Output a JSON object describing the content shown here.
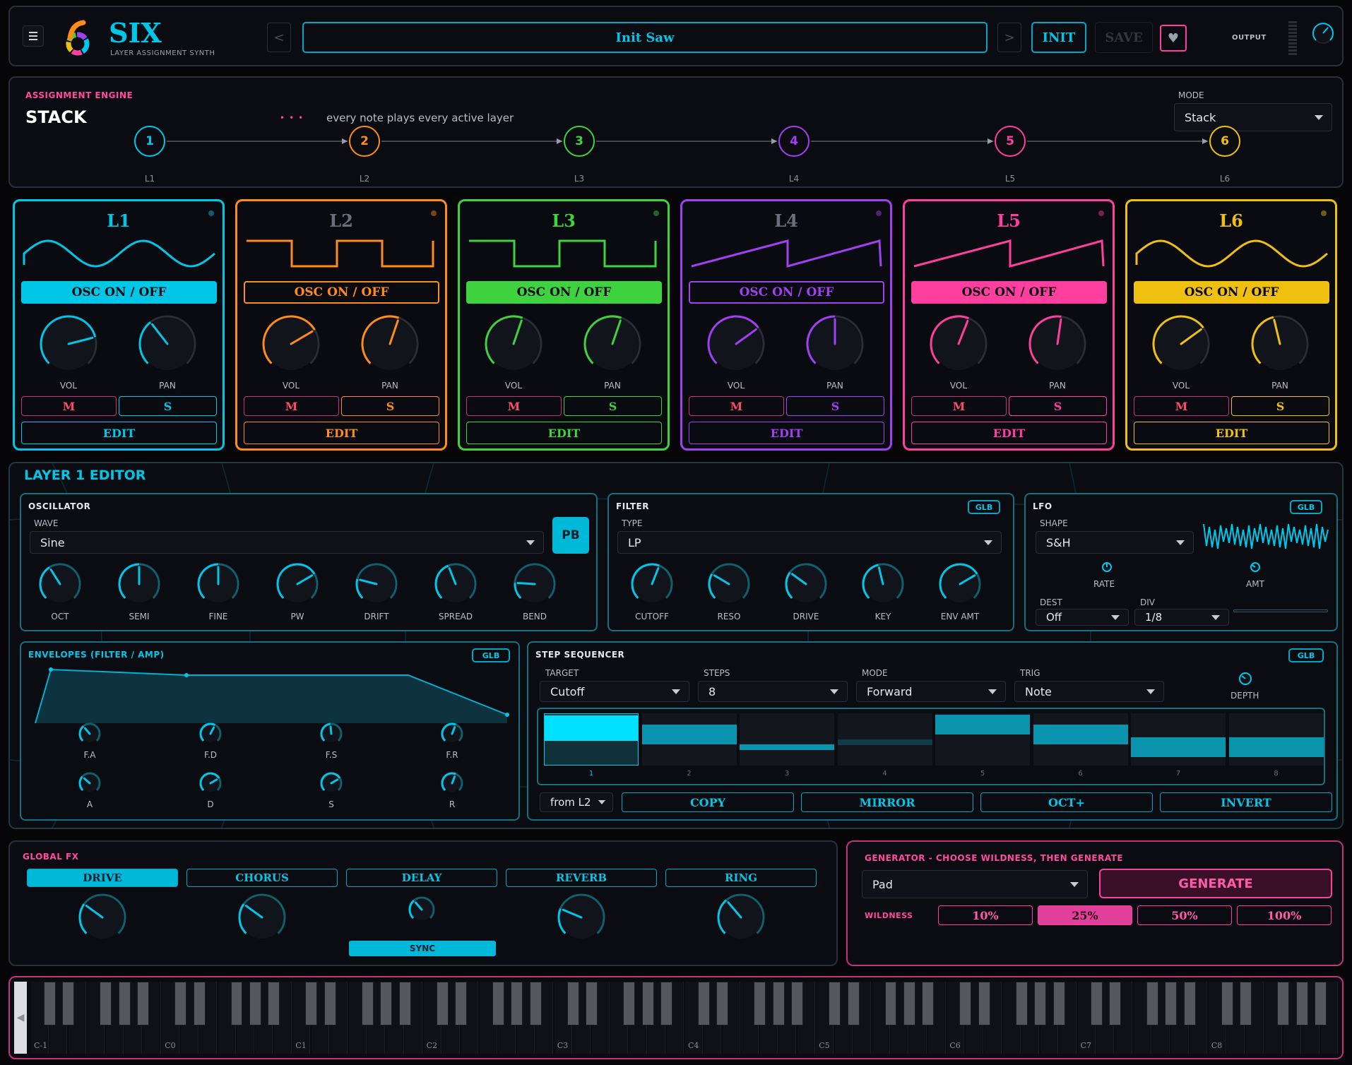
{
  "header": {
    "menu_icon": "hamburger-icon",
    "logo_icon": "six-ring-logo",
    "title": "SIX",
    "subtitle": "LAYER ASSIGNMENT SYNTH",
    "prev": "<",
    "preset": "Init Saw",
    "next": ">",
    "init": "INIT",
    "save": "SAVE",
    "favorite_icon": "heart-icon",
    "output_label": "OUTPUT"
  },
  "engine": {
    "label": "ASSIGNMENT ENGINE",
    "mode_name": "STACK",
    "description": "every note plays every active layer",
    "mode_label": "MODE",
    "mode_value": "Stack",
    "nodes": [
      {
        "num": "1",
        "label": "L1",
        "color": "#00c6e8"
      },
      {
        "num": "2",
        "label": "L2",
        "color": "#ff8c1a"
      },
      {
        "num": "3",
        "label": "L3",
        "color": "#3fd23f"
      },
      {
        "num": "4",
        "label": "L4",
        "color": "#a040f0"
      },
      {
        "num": "5",
        "label": "L5",
        "color": "#ff3fa0"
      },
      {
        "num": "6",
        "label": "L6",
        "color": "#f0c010"
      }
    ]
  },
  "layers": [
    {
      "title": "L1",
      "color": "#00c6e8",
      "wave": "sine",
      "osc": "OSC ON / OFF",
      "on": true,
      "vol": "VOL",
      "pan": "PAN",
      "m": "M",
      "s": "S",
      "edit": "EDIT",
      "vol_level": 0.78,
      "pan_level": 0.36,
      "title_color": "#00c6e8"
    },
    {
      "title": "L2",
      "color": "#ff8c1a",
      "wave": "square",
      "osc": "OSC ON / OFF",
      "on": false,
      "vol": "VOL",
      "pan": "PAN",
      "m": "M",
      "s": "S",
      "edit": "EDIT",
      "vol_level": 0.72,
      "pan_level": 0.57,
      "title_color": "#6c6f7a"
    },
    {
      "title": "L3",
      "color": "#3fd23f",
      "wave": "square",
      "osc": "OSC ON / OFF",
      "on": true,
      "vol": "VOL",
      "pan": "PAN",
      "m": "M",
      "s": "S",
      "edit": "EDIT",
      "vol_level": 0.57,
      "pan_level": 0.57,
      "title_color": "#3fd23f"
    },
    {
      "title": "L4",
      "color": "#a040f0",
      "wave": "saw",
      "osc": "OSC ON / OFF",
      "on": false,
      "vol": "VOL",
      "pan": "PAN",
      "m": "M",
      "s": "S",
      "edit": "EDIT",
      "vol_level": 0.7,
      "pan_level": 0.5,
      "title_color": "#6c6f7a"
    },
    {
      "title": "L5",
      "color": "#ff3fa0",
      "wave": "saw",
      "osc": "OSC ON / OFF",
      "on": true,
      "vol": "VOL",
      "pan": "PAN",
      "m": "M",
      "s": "S",
      "edit": "EDIT",
      "vol_level": 0.58,
      "pan_level": 0.53,
      "title_color": "#ff3fa0"
    },
    {
      "title": "L6",
      "color": "#f0c010",
      "wave": "sine",
      "osc": "OSC ON / OFF",
      "on": true,
      "vol": "VOL",
      "pan": "PAN",
      "m": "M",
      "s": "S",
      "edit": "EDIT",
      "vol_level": 0.7,
      "pan_level": 0.45,
      "title_color": "#f0c010"
    }
  ],
  "editor": {
    "title": "LAYER 1 EDITOR",
    "osc": {
      "label": "OSCILLATOR",
      "wave_label": "WAVE",
      "wave": "Sine",
      "pb": "PB",
      "knobs": [
        {
          "label": "OCT",
          "level": 0.38
        },
        {
          "label": "SEMI",
          "level": 0.5
        },
        {
          "label": "FINE",
          "level": 0.5
        },
        {
          "label": "PW",
          "level": 0.72
        },
        {
          "label": "DRIFT",
          "level": 0.22
        },
        {
          "label": "SPREAD",
          "level": 0.42
        },
        {
          "label": "BEND",
          "level": 0.18
        }
      ]
    },
    "filter": {
      "label": "FILTER",
      "glb": "GLB",
      "type_label": "TYPE",
      "type": "LP",
      "knobs": [
        {
          "label": "CUTOFF",
          "level": 0.58
        },
        {
          "label": "RESO",
          "level": 0.28
        },
        {
          "label": "DRIVE",
          "level": 0.3
        },
        {
          "label": "KEY",
          "level": 0.45
        },
        {
          "label": "ENV AMT",
          "level": 0.72
        }
      ]
    },
    "lfo": {
      "label": "LFO",
      "glb": "GLB",
      "shape_label": "SHAPE",
      "shape": "S&H",
      "rate": "RATE",
      "amt": "AMT",
      "dest_label": "DEST",
      "dest": "Off",
      "div_label": "DIV",
      "div": "1/8"
    },
    "env": {
      "label": "ENVELOPES  (FILTER / AMP)",
      "glb": "GLB",
      "knobs": [
        {
          "label": "F.A",
          "level": 0.35
        },
        {
          "label": "F.D",
          "level": 0.6
        },
        {
          "label": "F.S",
          "level": 0.48
        },
        {
          "label": "F.R",
          "level": 0.58
        },
        {
          "label": "A",
          "level": 0.32
        },
        {
          "label": "D",
          "level": 0.72
        },
        {
          "label": "S",
          "level": 0.72
        },
        {
          "label": "R",
          "level": 0.58
        }
      ]
    },
    "seq": {
      "label": "STEP SEQUENCER",
      "glb": "GLB",
      "target_label": "TARGET",
      "target": "Cutoff",
      "steps_label": "STEPS",
      "steps": "8",
      "mode_label": "MODE",
      "mode": "Forward",
      "trig_label": "TRIG",
      "trig": "Note",
      "depth": "DEPTH",
      "values": [
        1.0,
        0.8,
        0.4,
        0.5,
        1.0,
        0.8,
        0.55,
        0.55
      ],
      "step_labels": [
        "1",
        "2",
        "3",
        "4",
        "5",
        "6",
        "7",
        "8"
      ],
      "from": "from L2",
      "actions": [
        "COPY",
        "MIRROR",
        "OCT+",
        "INVERT"
      ]
    }
  },
  "fx": {
    "label": "GLOBAL FX",
    "tabs": [
      "DRIVE",
      "CHORUS",
      "DELAY",
      "REVERB",
      "RING"
    ],
    "sync": "SYNC"
  },
  "generator": {
    "label": "GENERATOR  -  CHOOSE WILDNESS, THEN GENERATE",
    "type": "Pad",
    "generate": "GENERATE",
    "wildness_label": "WILDNESS",
    "wildness": [
      "10%",
      "25%",
      "50%",
      "100%"
    ],
    "active": "25%"
  },
  "keyboard": {
    "octaves": [
      "C-1",
      "C0",
      "C1",
      "C2",
      "C3",
      "C4",
      "C5",
      "C6",
      "C7",
      "C8"
    ]
  }
}
